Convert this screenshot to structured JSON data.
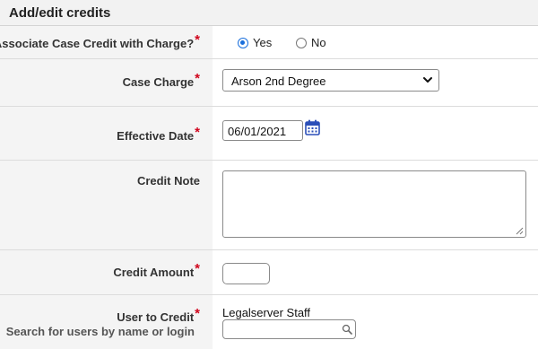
{
  "header": {
    "title": "Add/edit credits"
  },
  "associate": {
    "label": "Associate Case Credit with Charge?",
    "options": [
      {
        "label": "Yes",
        "selected": true
      },
      {
        "label": "No",
        "selected": false
      }
    ]
  },
  "case_charge": {
    "label": "Case Charge",
    "selected_value": "Arson 2nd Degree"
  },
  "effective_date": {
    "label": "Effective Date",
    "value": "06/01/2021"
  },
  "credit_note": {
    "label": "Credit Note",
    "value": ""
  },
  "credit_amount": {
    "label": "Credit Amount",
    "value": ""
  },
  "user_to_credit": {
    "label": "User to Credit",
    "sublabel": "Search for users by name or login",
    "current_user": "Legalserver Staff",
    "search_value": ""
  },
  "required_marker": "*",
  "colors": {
    "accent": "#1a6fdc",
    "required": "#d0021b",
    "label_bg": "#f4f4f4",
    "calendar_icon": "#2b4fb8"
  }
}
